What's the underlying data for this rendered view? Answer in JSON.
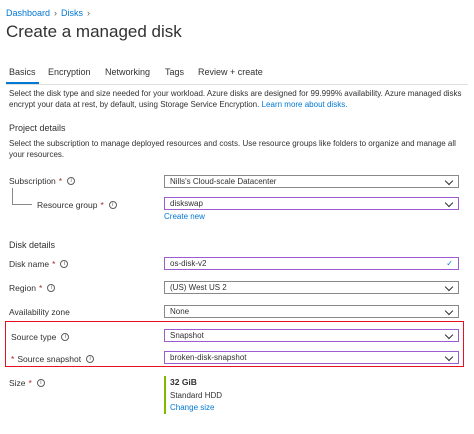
{
  "breadcrumb": [
    "Dashboard",
    "Disks"
  ],
  "page_title": "Create a managed disk",
  "tabs": [
    {
      "label": "Basics",
      "active": true
    },
    {
      "label": "Encryption",
      "active": false
    },
    {
      "label": "Networking",
      "active": false
    },
    {
      "label": "Tags",
      "active": false
    },
    {
      "label": "Review + create",
      "active": false
    }
  ],
  "intro": {
    "text": "Select the disk type and size needed for your workload. Azure disks are designed for 99.999% availability. Azure managed disks encrypt your data at rest, by default, using Storage Service Encryption.",
    "link": "Learn more about disks."
  },
  "project_details": {
    "heading": "Project details",
    "description": "Select the subscription to manage deployed resources and costs. Use resource groups like folders to organize and manage all your resources.",
    "subscription_label": "Subscription",
    "subscription_value": "Nills's Cloud-scale Datacenter",
    "resource_group_label": "Resource group",
    "resource_group_value": "diskswap",
    "create_new": "Create new"
  },
  "disk_details": {
    "heading": "Disk details",
    "disk_name_label": "Disk name",
    "disk_name_value": "os-disk-v2",
    "region_label": "Region",
    "region_value": "(US) West US 2",
    "availability_label": "Availability zone",
    "availability_value": "None",
    "source_type_label": "Source type",
    "source_type_value": "Snapshot",
    "source_snapshot_label": "Source snapshot",
    "source_snapshot_value": "broken-disk-snapshot",
    "size_label": "Size",
    "size_value": "32 GiB",
    "size_tier": "Standard HDD",
    "change_size": "Change size"
  },
  "colors": {
    "accent": "#0078d4",
    "highlight": "#e81123",
    "required": "#a4262c",
    "focus": "#9c5bce",
    "size_bar": "#7fba00"
  },
  "icons": {
    "info": "info-icon",
    "chevron": "chevron-down-icon",
    "check": "check-icon",
    "breadcrumb_sep": "chevron-right-icon"
  }
}
